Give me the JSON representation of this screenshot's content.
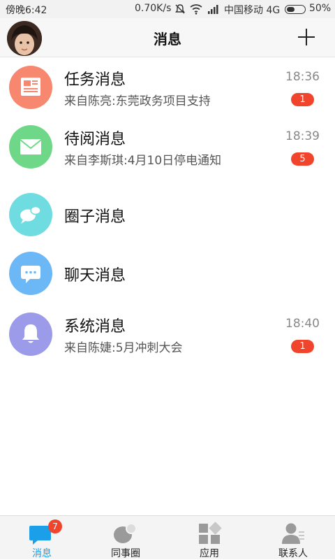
{
  "status_bar": {
    "time": "傍晚6:42",
    "network_speed": "0.70K/s",
    "carrier": "中国移动 4G",
    "battery_percent": "50%",
    "battery_level": 0.5
  },
  "header": {
    "title": "消息",
    "add_icon": "plus-icon",
    "avatar_icon": "user-avatar"
  },
  "messages": [
    {
      "title": "任务消息",
      "subtitle": "来自陈亮:东莞政务项目支持",
      "time": "18:36",
      "badge": "1",
      "icon": "newspaper-icon",
      "color": "#f7876f"
    },
    {
      "title": "待阅消息",
      "subtitle": "来自李斯琪:4月10日停电通知",
      "time": "18:39",
      "badge": "5",
      "icon": "envelope-icon",
      "color": "#6fd888"
    },
    {
      "title": "圈子消息",
      "subtitle": "",
      "time": "",
      "badge": "",
      "icon": "chat-bubbles-icon",
      "color": "#6fdce2"
    },
    {
      "title": "聊天消息",
      "subtitle": "",
      "time": "",
      "badge": "",
      "icon": "chat-dots-icon",
      "color": "#6cb7f5"
    },
    {
      "title": "系统消息",
      "subtitle": "来自陈婕:5月冲刺大会",
      "time": "18:40",
      "badge": "1",
      "icon": "bell-icon",
      "color": "#9b9bea"
    }
  ],
  "bottom_nav": [
    {
      "label": "消息",
      "icon": "message-icon",
      "badge": "7",
      "active": true
    },
    {
      "label": "同事圈",
      "icon": "colleague-circle-icon",
      "badge": "",
      "active": false
    },
    {
      "label": "应用",
      "icon": "apps-grid-icon",
      "badge": "",
      "active": false
    },
    {
      "label": "联系人",
      "icon": "contacts-icon",
      "badge": "",
      "active": false
    }
  ],
  "colors": {
    "accent": "#1a9fe8",
    "badge": "#f0442c",
    "inactive_icon": "#9a9a9a"
  }
}
